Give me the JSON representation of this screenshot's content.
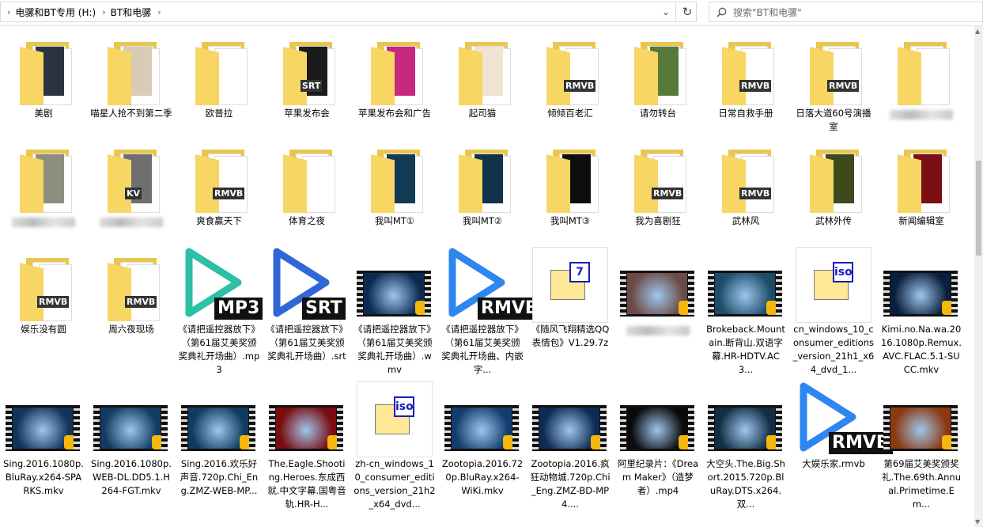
{
  "address": {
    "crumbs": [
      "电骡和BT专用 (H:)",
      "BT和电骡"
    ]
  },
  "search": {
    "placeholder": "搜索\"BT和电骡\""
  },
  "icons": {
    "dropdown": "chevron-down-icon",
    "refresh": "refresh-icon",
    "search": "search-icon",
    "player_badge": "player-icon"
  },
  "colors": {
    "folder": "#f7d664",
    "mp3_play": "#2cc0a4",
    "srt_play": "#2f67d6",
    "rmvb_play": "#2e86f0",
    "iso_badge": "#1a1ac0",
    "player_badge": "#f5b70a"
  },
  "items": [
    {
      "label": "美剧",
      "kind": "folder",
      "color": "#2a3342"
    },
    {
      "label": "喵星人抢不到第二季",
      "kind": "folder",
      "color": "#d9cbb5"
    },
    {
      "label": "欧普拉",
      "kind": "folder",
      "color": ""
    },
    {
      "label": "苹果发布会",
      "kind": "folder",
      "color": "#1b1b1b",
      "badge": "SRT"
    },
    {
      "label": "苹果发布会和广告",
      "kind": "folder",
      "color": "#c7287f"
    },
    {
      "label": "起司猫",
      "kind": "folder",
      "color": "#f0e3d1"
    },
    {
      "label": "倾倾百老汇",
      "kind": "folder",
      "color": "",
      "badge": "RMVB"
    },
    {
      "label": "请勿转台",
      "kind": "folder",
      "color": "#577a3a"
    },
    {
      "label": "日常自救手册",
      "kind": "folder",
      "color": "",
      "badge": "RMVB"
    },
    {
      "label": "日落大道60号演播室",
      "kind": "folder",
      "color": "",
      "badge": "RMVB"
    },
    {
      "label": "",
      "kind": "folder",
      "color": "",
      "blurred": true
    },
    {
      "label": "",
      "kind": "folder",
      "color": "#8e8e7e",
      "blurred": true
    },
    {
      "label": "",
      "kind": "folder",
      "color": "#6f6f72",
      "badge": "KV",
      "blurred": true
    },
    {
      "label": "爽食赢天下",
      "kind": "folder",
      "color": "",
      "badge": "RMVB"
    },
    {
      "label": "体育之夜",
      "kind": "folder",
      "color": ""
    },
    {
      "label": "我叫MT①",
      "kind": "folder",
      "color": "#113a55"
    },
    {
      "label": "我叫MT②",
      "kind": "folder",
      "color": "#10324a"
    },
    {
      "label": "我叫MT③",
      "kind": "folder",
      "color": "#0e0e0e"
    },
    {
      "label": "我为喜剧狂",
      "kind": "folder",
      "color": "",
      "badge": "RMVB"
    },
    {
      "label": "武林风",
      "kind": "folder",
      "color": "",
      "badge": "RMVB"
    },
    {
      "label": "武林外传",
      "kind": "folder",
      "color": "#3d4a1c"
    },
    {
      "label": "新闻编辑室",
      "kind": "folder",
      "color": "#7a0f14"
    },
    {
      "label": "娱乐没有圆",
      "kind": "folder",
      "color": "",
      "badge": "RMVB"
    },
    {
      "label": "周六夜现场",
      "kind": "folder",
      "color": "",
      "badge": "RMVB"
    },
    {
      "label": "《请把遥控器放下》（第61届艾美奖颁奖典礼开场曲）.mp3",
      "kind": "play",
      "color": "#2cc0a4",
      "badge": "MP3"
    },
    {
      "label": "《请把遥控器放下》（第61届艾美奖颁奖典礼开场曲）.srt",
      "kind": "play",
      "color": "#2f67d6",
      "badge": "SRT"
    },
    {
      "label": "《请把遥控器放下》（第61届艾美奖颁奖典礼开场曲）.wmv",
      "kind": "video",
      "color": "#0b2a52"
    },
    {
      "label": "《请把遥控器放下》（第61届艾美奖颁奖典礼开场曲、内嵌字...",
      "kind": "play",
      "color": "#2e86f0",
      "badge": "RMVB"
    },
    {
      "label": "《随风飞翔精选QQ表情包》V1.29.7z",
      "kind": "doc",
      "badge": "7"
    },
    {
      "label": "",
      "kind": "video",
      "color": "#6b4a44",
      "blurred": true
    },
    {
      "label": "Brokeback.Mountain.断背山.双语字幕.HR-HDTV.AC3...",
      "kind": "video",
      "color": "#1c4c68"
    },
    {
      "label": "cn_windows_10_consumer_editions_version_21h1_x64_dvd_1...",
      "kind": "doc",
      "badge": "iso"
    },
    {
      "label": "Kimi.no.Na.wa.2016.1080p.Remux.AVC.FLAC.5.1-SUCC.mkv",
      "kind": "video",
      "color": "#0a1f3d"
    },
    {
      "label": "Sing.2016.1080p.BluRay.x264-SPARKS.mkv",
      "kind": "video",
      "color": "#12335a"
    },
    {
      "label": "Sing.2016.1080p.WEB-DL.DD5.1.H264-FGT.mkv",
      "kind": "video",
      "color": "#123a62"
    },
    {
      "label": "Sing.2016.欢乐好声音.720p.Chi_Eng.ZMZ-WEB-MP...",
      "kind": "video",
      "color": "#103a60"
    },
    {
      "label": "The.Eagle.Shooting.Heroes.东成西就.中文字幕.国粤音轨.HR-H...",
      "kind": "video",
      "color": "#7a0c10"
    },
    {
      "label": "zh-cn_windows_10_consumer_editions_version_21h2_x64_dvd...",
      "kind": "doc",
      "badge": "iso"
    },
    {
      "label": "Zootopia.2016.720p.BluRay.x264-WiKi.mkv",
      "kind": "video",
      "color": "#133d6e"
    },
    {
      "label": "Zootopia.2016.疯狂动物城.720p.Chi_Eng.ZMZ-BD-MP4....",
      "kind": "video",
      "color": "#0d2c55"
    },
    {
      "label": "阿里纪录片：《Dream Maker》（造梦者）.mp4",
      "kind": "video",
      "color": "#0a0a0a"
    },
    {
      "label": "大空头.The.Big.Short.2015.720p.BluRay.DTS.x264.双...",
      "kind": "video",
      "color": "#122d44"
    },
    {
      "label": "大娱乐家.rmvb",
      "kind": "play",
      "color": "#2e86f0",
      "badge": "RMVB"
    },
    {
      "label": "第69届艾美奖颁奖礼.The.69th.Annual.Primetime.Em...",
      "kind": "video",
      "color": "#8a3a10"
    }
  ]
}
